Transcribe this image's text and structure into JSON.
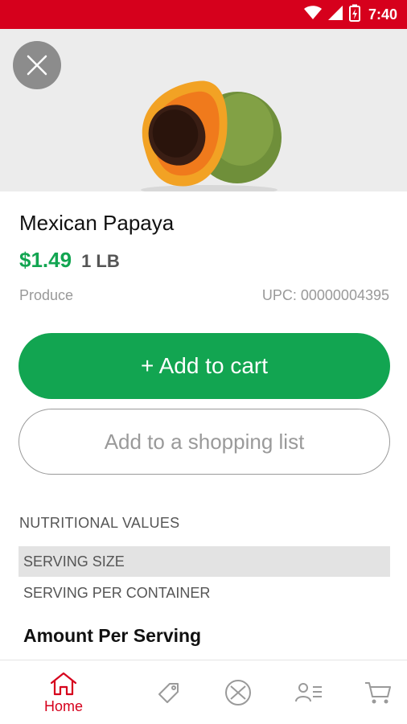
{
  "status_bar": {
    "time": "7:40"
  },
  "product": {
    "name": "Mexican Papaya",
    "price": "$1.49",
    "unit": "1 LB",
    "category": "Produce",
    "upc": "UPC: 00000004395"
  },
  "actions": {
    "add_to_cart": "+ Add to cart",
    "add_to_list": "Add to a shopping list"
  },
  "nutrition": {
    "heading": "NUTRITIONAL VALUES",
    "rows": [
      "SERVING SIZE",
      "SERVING PER CONTAINER"
    ],
    "amount_heading": "Amount Per Serving"
  },
  "nav": {
    "items": [
      {
        "label": "Home",
        "icon": "home-icon",
        "active": true
      },
      {
        "label": "",
        "icon": "tag-icon"
      },
      {
        "label": "",
        "icon": "circle-x-icon"
      },
      {
        "label": "",
        "icon": "user-list-icon"
      },
      {
        "label": "",
        "icon": "cart-icon"
      }
    ]
  },
  "colors": {
    "brand_red": "#d6001c",
    "price_green": "#12a551",
    "cart_button_green": "#12a551"
  }
}
